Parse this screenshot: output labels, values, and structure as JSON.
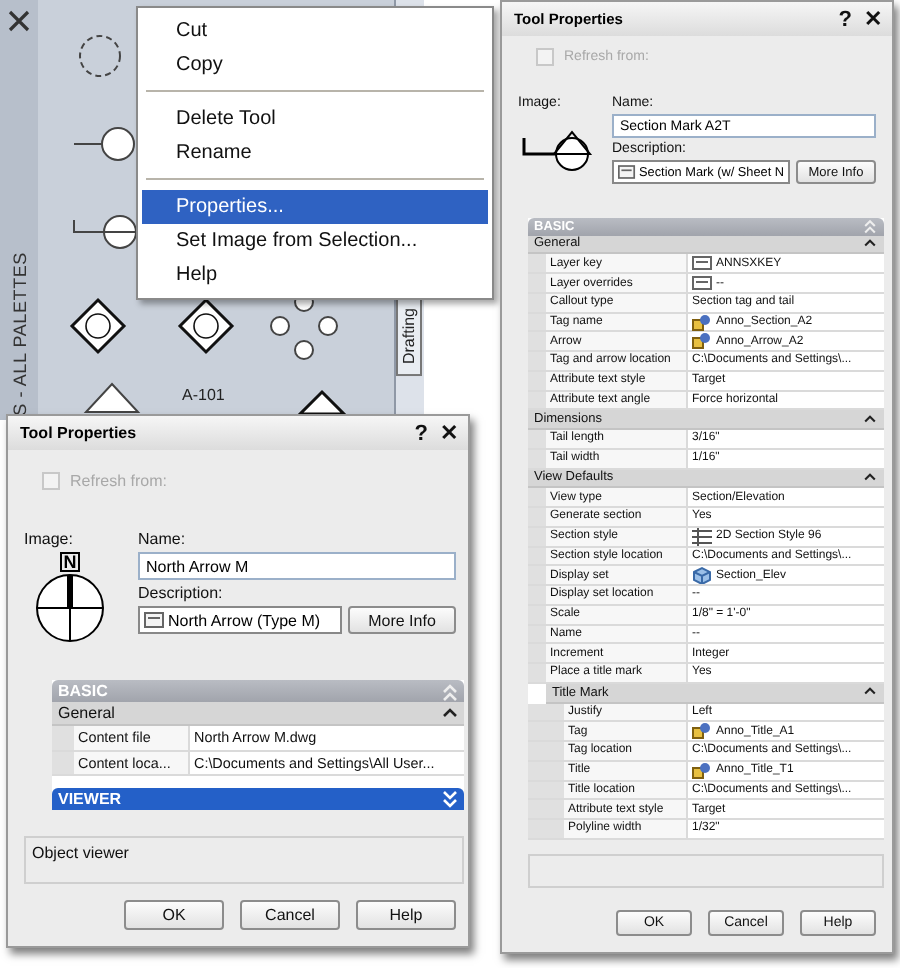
{
  "palette": {
    "title": "S - ALL PALETTES",
    "tab": "Drafting",
    "symbol_label": "A-101"
  },
  "context_menu": {
    "items": [
      {
        "kind": "item",
        "label": "Cut",
        "selected": false
      },
      {
        "kind": "item",
        "label": "Copy",
        "selected": false
      },
      {
        "kind": "separator"
      },
      {
        "kind": "item",
        "label": "Delete Tool",
        "selected": false
      },
      {
        "kind": "item",
        "label": "Rename",
        "selected": false
      },
      {
        "kind": "separator"
      },
      {
        "kind": "item",
        "label": "Properties...",
        "selected": true
      },
      {
        "kind": "item",
        "label": "Set Image from Selection...",
        "selected": false
      },
      {
        "kind": "item",
        "label": "Help",
        "selected": false
      }
    ]
  },
  "dialogs": [
    {
      "title": "Tool Properties",
      "title_buttons": [
        "?",
        "✕"
      ],
      "refresh": {
        "label": "Refresh from:",
        "checked": false,
        "disabled": true
      },
      "image_label": "Image:",
      "image": {
        "kind": "north-arrow",
        "text": "N"
      },
      "name_label": "Name:",
      "name_value": "North Arrow M",
      "description_label": "Description:",
      "description_value": "North Arrow (Type M)",
      "more_info": "More Info",
      "properties": [
        {
          "kind": "category",
          "label": "BASIC",
          "expanded": true,
          "selected": false,
          "items": [
            {
              "kind": "group",
              "label": "General",
              "expanded": true,
              "items": [
                {
                  "kind": "text",
                  "label": "Content file",
                  "value": "North Arrow M.dwg"
                },
                {
                  "kind": "text",
                  "label": "Content loca...",
                  "value": "C:\\Documents and Settings\\All User..."
                }
              ]
            }
          ]
        },
        {
          "kind": "category",
          "label": "VIEWER",
          "expanded": false,
          "selected": true
        }
      ],
      "viewer_text": "Object viewer",
      "buttons": [
        "OK",
        "Cancel",
        "Help"
      ]
    },
    {
      "title": "Tool Properties",
      "title_buttons": [
        "?",
        "✕"
      ],
      "refresh": {
        "label": "Refresh from:",
        "checked": false,
        "disabled": true
      },
      "image_label": "Image:",
      "image": {
        "kind": "section-mark"
      },
      "name_label": "Name:",
      "name_value": "Section Mark A2T",
      "description_label": "Description:",
      "description_value": "Section Mark (w/ Sheet N",
      "more_info": "More Info",
      "properties": [
        {
          "kind": "category",
          "label": "BASIC",
          "expanded": true,
          "selected": false,
          "items": [
            {
              "kind": "group",
              "label": "General",
              "expanded": true,
              "items": [
                {
                  "kind": "layer",
                  "label": "Layer key",
                  "value": "ANNSXKEY"
                },
                {
                  "kind": "layer",
                  "label": "Layer overrides",
                  "value": "--"
                },
                {
                  "kind": "text",
                  "label": "Callout type",
                  "value": "Section tag and tail"
                },
                {
                  "kind": "block",
                  "label": "Tag name",
                  "value": "Anno_Section_A2"
                },
                {
                  "kind": "block",
                  "label": "Arrow",
                  "value": "Anno_Arrow_A2"
                },
                {
                  "kind": "text",
                  "label": "Tag and arrow location",
                  "value": "C:\\Documents and Settings\\..."
                },
                {
                  "kind": "text",
                  "label": "Attribute text style",
                  "value": "Target"
                },
                {
                  "kind": "text",
                  "label": "Attribute text angle",
                  "value": "Force horizontal"
                }
              ]
            },
            {
              "kind": "group",
              "label": "Dimensions",
              "expanded": true,
              "items": [
                {
                  "kind": "text",
                  "label": "Tail length",
                  "value": "3/16\""
                },
                {
                  "kind": "text",
                  "label": "Tail width",
                  "value": "1/16\""
                }
              ]
            },
            {
              "kind": "group",
              "label": "View Defaults",
              "expanded": true,
              "items": [
                {
                  "kind": "text",
                  "label": "View type",
                  "value": "Section/Elevation"
                },
                {
                  "kind": "text",
                  "label": "Generate section",
                  "value": "Yes"
                },
                {
                  "kind": "style",
                  "label": "Section style",
                  "value": "2D Section Style 96"
                },
                {
                  "kind": "text",
                  "label": "Section style location",
                  "value": "C:\\Documents and Settings\\..."
                },
                {
                  "kind": "displayset",
                  "label": "Display set",
                  "value": "Section_Elev"
                },
                {
                  "kind": "text",
                  "label": "Display set location",
                  "value": "--"
                },
                {
                  "kind": "text",
                  "label": "Scale",
                  "value": "1/8\" = 1'-0\""
                },
                {
                  "kind": "text",
                  "label": "Name",
                  "value": "--"
                },
                {
                  "kind": "text",
                  "label": "Increment",
                  "value": "Integer"
                },
                {
                  "kind": "text",
                  "label": "Place a title mark",
                  "value": "Yes"
                },
                {
                  "kind": "group",
                  "label": "Title Mark",
                  "expanded": true,
                  "items": [
                    {
                      "kind": "text",
                      "label": "Justify",
                      "value": "Left"
                    },
                    {
                      "kind": "block",
                      "label": "Tag",
                      "value": "Anno_Title_A1"
                    },
                    {
                      "kind": "text",
                      "label": "Tag location",
                      "value": "C:\\Documents and Settings\\..."
                    },
                    {
                      "kind": "block",
                      "label": "Title",
                      "value": "Anno_Title_T1"
                    },
                    {
                      "kind": "text",
                      "label": "Title location",
                      "value": "C:\\Documents and Settings\\..."
                    },
                    {
                      "kind": "text",
                      "label": "Attribute text style",
                      "value": "Target"
                    },
                    {
                      "kind": "text",
                      "label": "Polyline width",
                      "value": "1/32\""
                    }
                  ]
                }
              ]
            }
          ]
        }
      ],
      "buttons": [
        "OK",
        "Cancel",
        "Help"
      ]
    }
  ]
}
